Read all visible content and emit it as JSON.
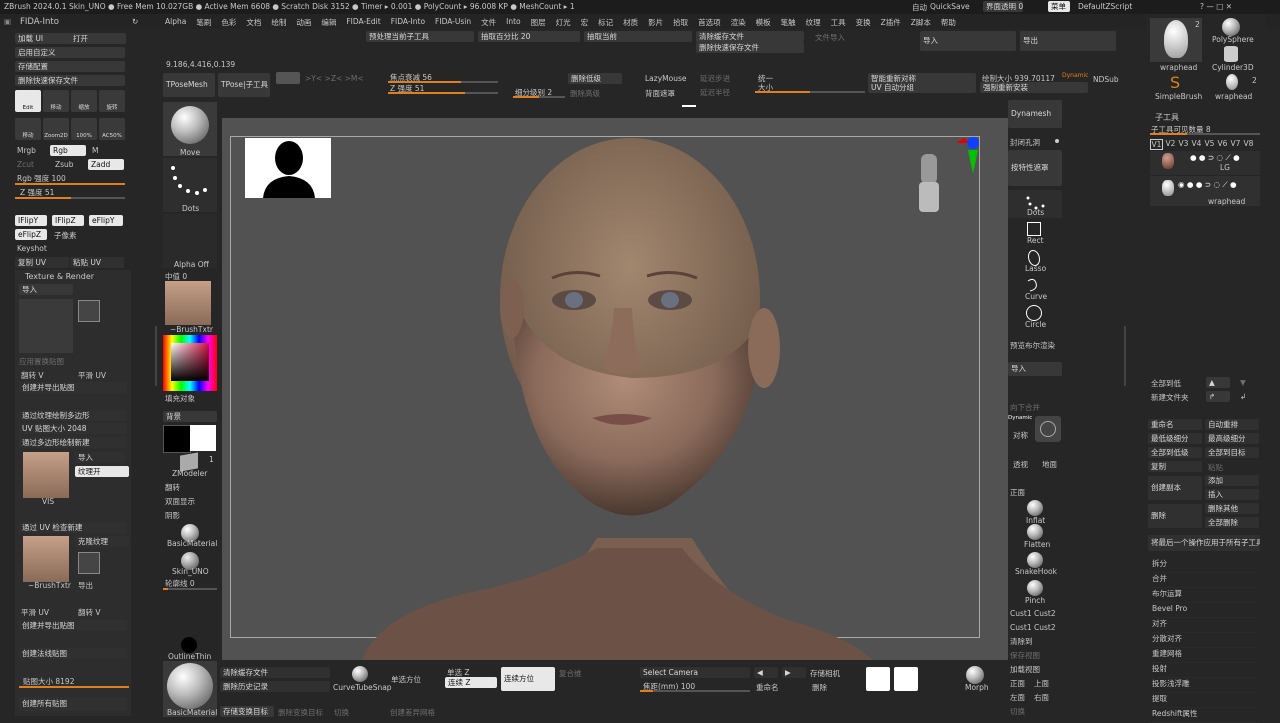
{
  "titlebar": {
    "left": "ZBrush 2024.0.1   Skin_UNO  ● Free Mem 10.027GB ● Active Mem 6608 ● Scratch Disk 3152 ● Timer ▸ 0.001 ● PolyCount ▸ 96.008 KP ● MeshCount ▸ 1",
    "ai": "自动",
    "quicksave": "QuickSave",
    "transparency": "界面透明 0",
    "menu": "菜单",
    "script": "DefaultZScript",
    "controls": "?  —  □  ✕"
  },
  "menubar": {
    "plugin": "FIDA-Into",
    "items": [
      "Alpha",
      "笔刷",
      "色彩",
      "文档",
      "绘制",
      "动画",
      "编辑",
      "FIDA-Edit",
      "FIDA-Into",
      "FIDA-Usin",
      "文件",
      "Into",
      "图层",
      "灯光",
      "宏",
      "标记",
      "材质",
      "影片",
      "拾取",
      "首选项",
      "渲染",
      "模板",
      "笔触",
      "纹理",
      "工具",
      "变换",
      "Z插件",
      "Z脚本",
      "帮助"
    ]
  },
  "left_panel": {
    "load_ui": "加载 UI",
    "open": "打开",
    "enable_custom": "启用自定义",
    "save_config": "存储配置",
    "delete_quicksave": "删除快速保存文件",
    "tool_buttons": [
      "Edit",
      "移动",
      "缩放",
      "旋转"
    ],
    "tool_buttons2": [
      "移动",
      "Zoom2D",
      "100%",
      "AC50%"
    ],
    "mrgb": "Mrgb",
    "rgb": "Rgb",
    "m": "M",
    "zcut": "Zcut",
    "zsub": "Zsub",
    "zadd": "Zadd",
    "rgb_strength": "Rgb 强度 100",
    "z_strength": "Z 强度 51",
    "flips": [
      "IFlipY",
      "IFlipZ",
      "eFlipY",
      "eFlipZ"
    ],
    "subpixel": "子像素",
    "keyshot": "Keyshot",
    "copy_uv": "复制 UV",
    "paste_uv": "粘贴 UV",
    "texture_render_title": "Texture & Render",
    "import": "导入",
    "map_gen": "应用置换贴图",
    "flip_v": "翻转 V",
    "smooth_uv": "平滑 UV",
    "create_export_map": "创建并导出贴图",
    "poly_map": "通过纹理绘制多边形",
    "uv_map_size": "UV 贴图大小 2048",
    "poly_new": "通过多边形绘制新建",
    "import2": "导入",
    "texture_on": "纹理开",
    "vis": "VIS",
    "uv_check": "通过 UV 检查新建",
    "clone_texture": "克隆纹理",
    "brushtxtr": "~BrushTxtr",
    "export": "导出",
    "smooth_uv2": "平滑 UV",
    "flip_v2": "翻转 V",
    "create_export_map2": "创建并导出贴图",
    "create_normal_map": "创建法线贴图",
    "map_size": "贴图大小 8192",
    "create_all_maps": "创建所有贴图"
  },
  "shelf": {
    "coord": "9.186,4.416,0.139",
    "tposemesh": "TPoseMesh",
    "tpose_sub": "TPose|子工具",
    "preprocess": "预处理当前子工具",
    "extract_pct": "抽取百分比 20",
    "extract_current": "抽取当前",
    "clear_cache": "清除缓存文件",
    "delete_quicksave": "删除快速保存文件",
    "file_import": "文件导入",
    "import": "导入",
    "export": "导出",
    "focal": "焦点衰减 56",
    "z_strength": "Z 强度 51",
    "subdiv": "细分级别 2",
    "delete_lower": "删除低级",
    "delete_higher": "删除高级",
    "lazymouse": "LazyMouse",
    "backface": "背面遮罩",
    "lazy_step": "延迟步进",
    "lazy_radius": "延迟半径",
    "unified": "统一",
    "size": "大小",
    "smart_resym": "智能重新对称",
    "uv_auto": "UV 自动分组",
    "draw_size": "绘制大小 939.70117",
    "dynamic": "Dynamic",
    "ndsub": "NDSub",
    "reinstall": "强制重新安装"
  },
  "left_tools": {
    "move": "Move",
    "dots": "Dots",
    "alpha_off": "Alpha Off",
    "center": "中值 0",
    "brushtxtr": "~BrushTxtr",
    "fill_object": "填充对象",
    "background": "背景",
    "zmodeler": "ZModeler",
    "zmodeler_count": "1",
    "flip": "翻转",
    "double": "双面显示",
    "shadow": "阴影",
    "basic_material": "BasicMaterial",
    "skin_uno": "Skin_UNO",
    "outline": "轮廓线 0"
  },
  "right_tools": {
    "dynamesh": "Dynamesh",
    "close_holes": "封闭孔洞",
    "by_feature": "按特性遮罩",
    "dots": "Dots",
    "rect": "Rect",
    "lasso": "Lasso",
    "curve": "Curve",
    "circle": "Circle",
    "preset_render": "预览布尔渲染",
    "import": "导入",
    "merge_down": "向下合并",
    "symmetry": "对称",
    "dynamic": "Dynamic",
    "perspective": "透视",
    "floor": "地面",
    "front": "正面",
    "inflat": "Inflat",
    "flatten": "Flatten",
    "snakehook": "SnakeHook",
    "pinch": "Pinch",
    "cust1": "Cust1",
    "cust2": "Cust2",
    "clear": "清除到",
    "save_view": "保存视图",
    "load_view": "加载视图",
    "top": "上面",
    "left": "左面",
    "right": "右面",
    "cut": "切换"
  },
  "bottom_bar": {
    "clear_cache": "清除缓存文件",
    "delete_history": "删除历史记录",
    "curve_tube": "CurveTubeSnap",
    "single_select": "单选方位",
    "single_z": "单选 Z",
    "continuous_z": "连续 Z",
    "continuous_dir": "连续方位",
    "composite": "复合维",
    "camera": "Select Camera",
    "focal": "焦距(mm) 100",
    "store_camera": "存储相机",
    "rename": "重命名",
    "delete": "删除",
    "save_transparent": "存储变换目标",
    "delete_transparent": "删除变换目标",
    "switch": "切换",
    "create_diff": "创建差异网格",
    "basic_material": "BasicMaterial",
    "outline_thin": "OutlineThin",
    "morph": "Morph"
  },
  "right_panel": {
    "tools": [
      {
        "name": "wraphead",
        "badge": "2"
      },
      {
        "name": "PolySphere",
        "badge": ""
      },
      {
        "name": "Cylinder3D",
        "badge": ""
      },
      {
        "name": "SimpleBrush",
        "badge": ""
      },
      {
        "name": "wraphead",
        "badge": "2"
      }
    ],
    "subtool_title": "子工具",
    "visible_count": "子工具可见数量 8",
    "versions": [
      "V1",
      "V2",
      "V3",
      "V4",
      "V5",
      "V6",
      "V7",
      "V8"
    ],
    "subtools": [
      {
        "name": "LG"
      },
      {
        "name": "wraphead"
      }
    ],
    "all_lower": "全部到低",
    "new_folder": "新建文件夹",
    "rename": "重命名",
    "auto_order": "自动重排",
    "all_low": "最低级细分",
    "all_high": "最高级细分",
    "all_to_low": "全部到低级",
    "all_to_target": "全部到目标",
    "copy": "复制",
    "paste": "粘贴",
    "create_copy": "创建副本",
    "add": "添加",
    "insert": "插入",
    "delete": "删除",
    "delete_others": "删除其他",
    "delete_all": "全部删除",
    "apply_last": "将最后一个操作应用于所有子工具",
    "split": "拆分",
    "merge": "合并",
    "boolean": "布尔运算",
    "bevel": "Bevel Pro",
    "align": "对齐",
    "distribute": "分散对齐",
    "remesh": "重建网格",
    "project": "投射",
    "project_shallow": "投影浅浮雕",
    "extract": "提取",
    "redshift": "Redshift属性"
  },
  "colors": {
    "accent": "#e0801a",
    "bg": "#262626",
    "canvas": "#525252",
    "panel": "#2d2d2d",
    "button": "#383838"
  }
}
